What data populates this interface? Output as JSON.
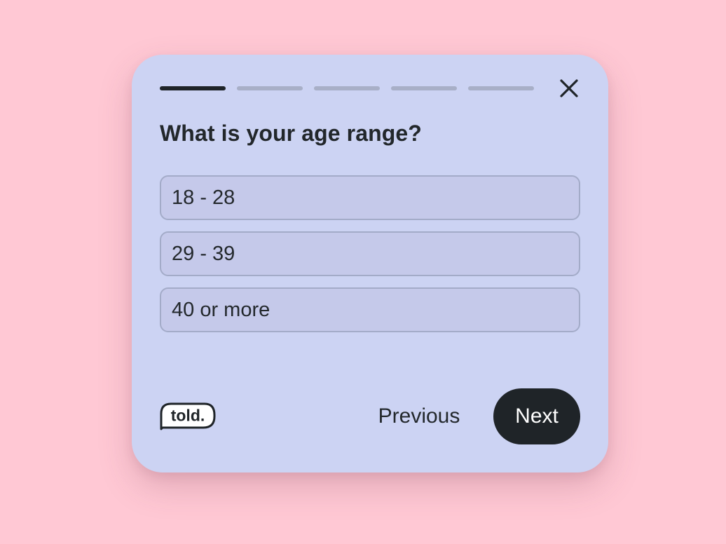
{
  "survey": {
    "progress": {
      "total_steps": 5,
      "current_step": 1
    },
    "question": "What is your age range?",
    "options": [
      {
        "label": "18 - 28"
      },
      {
        "label": "29 - 39"
      },
      {
        "label": "40 or more"
      }
    ],
    "nav": {
      "previous_label": "Previous",
      "next_label": "Next"
    },
    "brand": {
      "logo_text": "told."
    }
  },
  "colors": {
    "page_background": "#ffc8d4",
    "card_background": "#ccd3f3",
    "option_background": "#c5c9ea",
    "option_border": "#a3abc8",
    "progress_active": "#1f2428",
    "progress_inactive": "#a8afc7",
    "primary_button": "#1f2428",
    "text": "#23282c"
  },
  "icons": {
    "close": "close-icon"
  }
}
